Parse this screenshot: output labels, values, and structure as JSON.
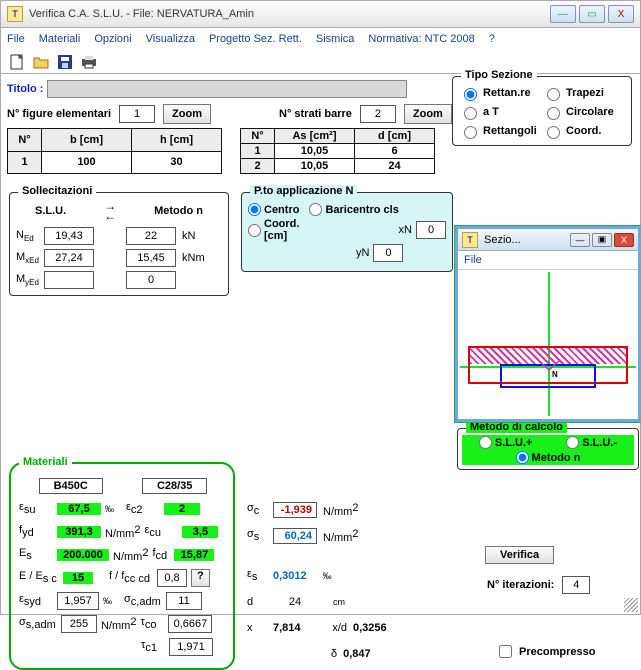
{
  "window": {
    "title": "Verifica C.A. S.L.U. - File: NERVATURA_Amin",
    "min": "—",
    "max": "▭",
    "close": "X"
  },
  "menu": {
    "file": "File",
    "materiali": "Materiali",
    "opzioni": "Opzioni",
    "visualizza": "Visualizza",
    "progetto": "Progetto Sez. Rett.",
    "sismica": "Sismica",
    "normativa": "Normativa: NTC 2008",
    "help": "?"
  },
  "titolo": {
    "label": "Titolo :",
    "value": ""
  },
  "figures": {
    "label": "N° figure elementari",
    "value": "1",
    "zoom": "Zoom"
  },
  "bars": {
    "label": "N° strati barre",
    "value": "2",
    "zoom": "Zoom"
  },
  "geom_table": {
    "headers": [
      "N°",
      "b [cm]",
      "h [cm]"
    ],
    "rows": [
      [
        "1",
        "100",
        "30"
      ]
    ]
  },
  "bars_table": {
    "headers": [
      "N°",
      "As [cm²]",
      "d [cm]"
    ],
    "rows": [
      [
        "1",
        "10,05",
        "6"
      ],
      [
        "2",
        "10,05",
        "24"
      ]
    ]
  },
  "tipo": {
    "title": "Tipo Sezione",
    "opts": {
      "r": "Rettan.re",
      "t": "Trapezi",
      "at": "a T",
      "c": "Circolare",
      "rg": "Rettangoli",
      "co": "Coord."
    }
  },
  "sezio": {
    "title": "Sezio...",
    "file": "File",
    "min": "—",
    "max": "▣",
    "close": "X",
    "n": "N"
  },
  "soll": {
    "title": "Sollecitazioni",
    "slu": "S.L.U.",
    "metodo": "Metodo n",
    "n": "19,43",
    "m_x": "27,24",
    "m_y": "",
    "n2": "22",
    "m2": "15,45",
    "m3": "0",
    "ukn": "kN",
    "uknm": "kNm",
    "n_lbl": "N",
    "m_lbl": "M",
    "ed": "Ed",
    "xed": "xEd",
    "yed": "yEd"
  },
  "pto": {
    "title": "P.to applicazione N",
    "centro": "Centro",
    "bari": "Baricentro cls",
    "coord": "Coord.[cm]",
    "xn": "xN",
    "yn": "yN",
    "xv": "0",
    "yv": "0"
  },
  "metodo_calc": {
    "title": "Metodo di calcolo",
    "sp": "S.L.U.+",
    "sm": "S.L.U.-",
    "mn": "Metodo n"
  },
  "materiali": {
    "title": "Materiali",
    "steel": "B450C",
    "concrete": "C28/35",
    "esu": "67,5",
    "ec2": "2",
    "fyd": "391,3",
    "ecu": "3,5",
    "es": "200.000",
    "fcd": "15,87",
    "esec": "15",
    "fccfcd": "0,8",
    "esyd": "1,957",
    "ocadm": "11",
    "osadm": "255",
    "tco": "0,6667",
    "tc1": "1,971",
    "l_esu": "ε",
    "l_su": "su",
    "l_ec2": "ε",
    "l_c2": "c2",
    "l_fyd": "f",
    "l_yd": "yd",
    "l_ecu": "ε",
    "l_cu": "cu",
    "l_es": "E",
    "l_s": "s",
    "l_fcd": "f",
    "l_cd": "cd",
    "l_ratio": "E  / E",
    "l_sc": "s    c",
    "l_fratio": "f   / f",
    "l_cccd": "cc    cd",
    "l_esyd": "ε",
    "l_syd": "syd",
    "l_ocadm": "σ",
    "l_cadm": "c,adm",
    "l_osadm": "σ",
    "l_sadm": "s,adm",
    "l_tco": "τ",
    "l_co": "co",
    "l_tc1": "τ",
    "l_c1": "c1",
    "permille": "‰",
    "nmm2": "N/mm",
    "sq": "2",
    "q": "?"
  },
  "results": {
    "oc": "-1,939",
    "os": "60,24",
    "es": "0,3012",
    "d": "24",
    "x": "7,814",
    "xd": "0,3256",
    "delta": "0,847",
    "l_oc": "σ",
    "l_c": "c",
    "l_os": "σ",
    "l_s": "s",
    "l_es": "ε",
    "l_ess": "s",
    "l_d": "d",
    "l_x": "x",
    "l_xd": "x/d",
    "l_del": "δ",
    "nmm2": "N/mm",
    "sq": "2",
    "permille": "‰",
    "cm": "cm"
  },
  "verifica": "Verifica",
  "niter": {
    "label": "N° iterazioni:",
    "value": "4"
  },
  "precomp": "Precompresso"
}
